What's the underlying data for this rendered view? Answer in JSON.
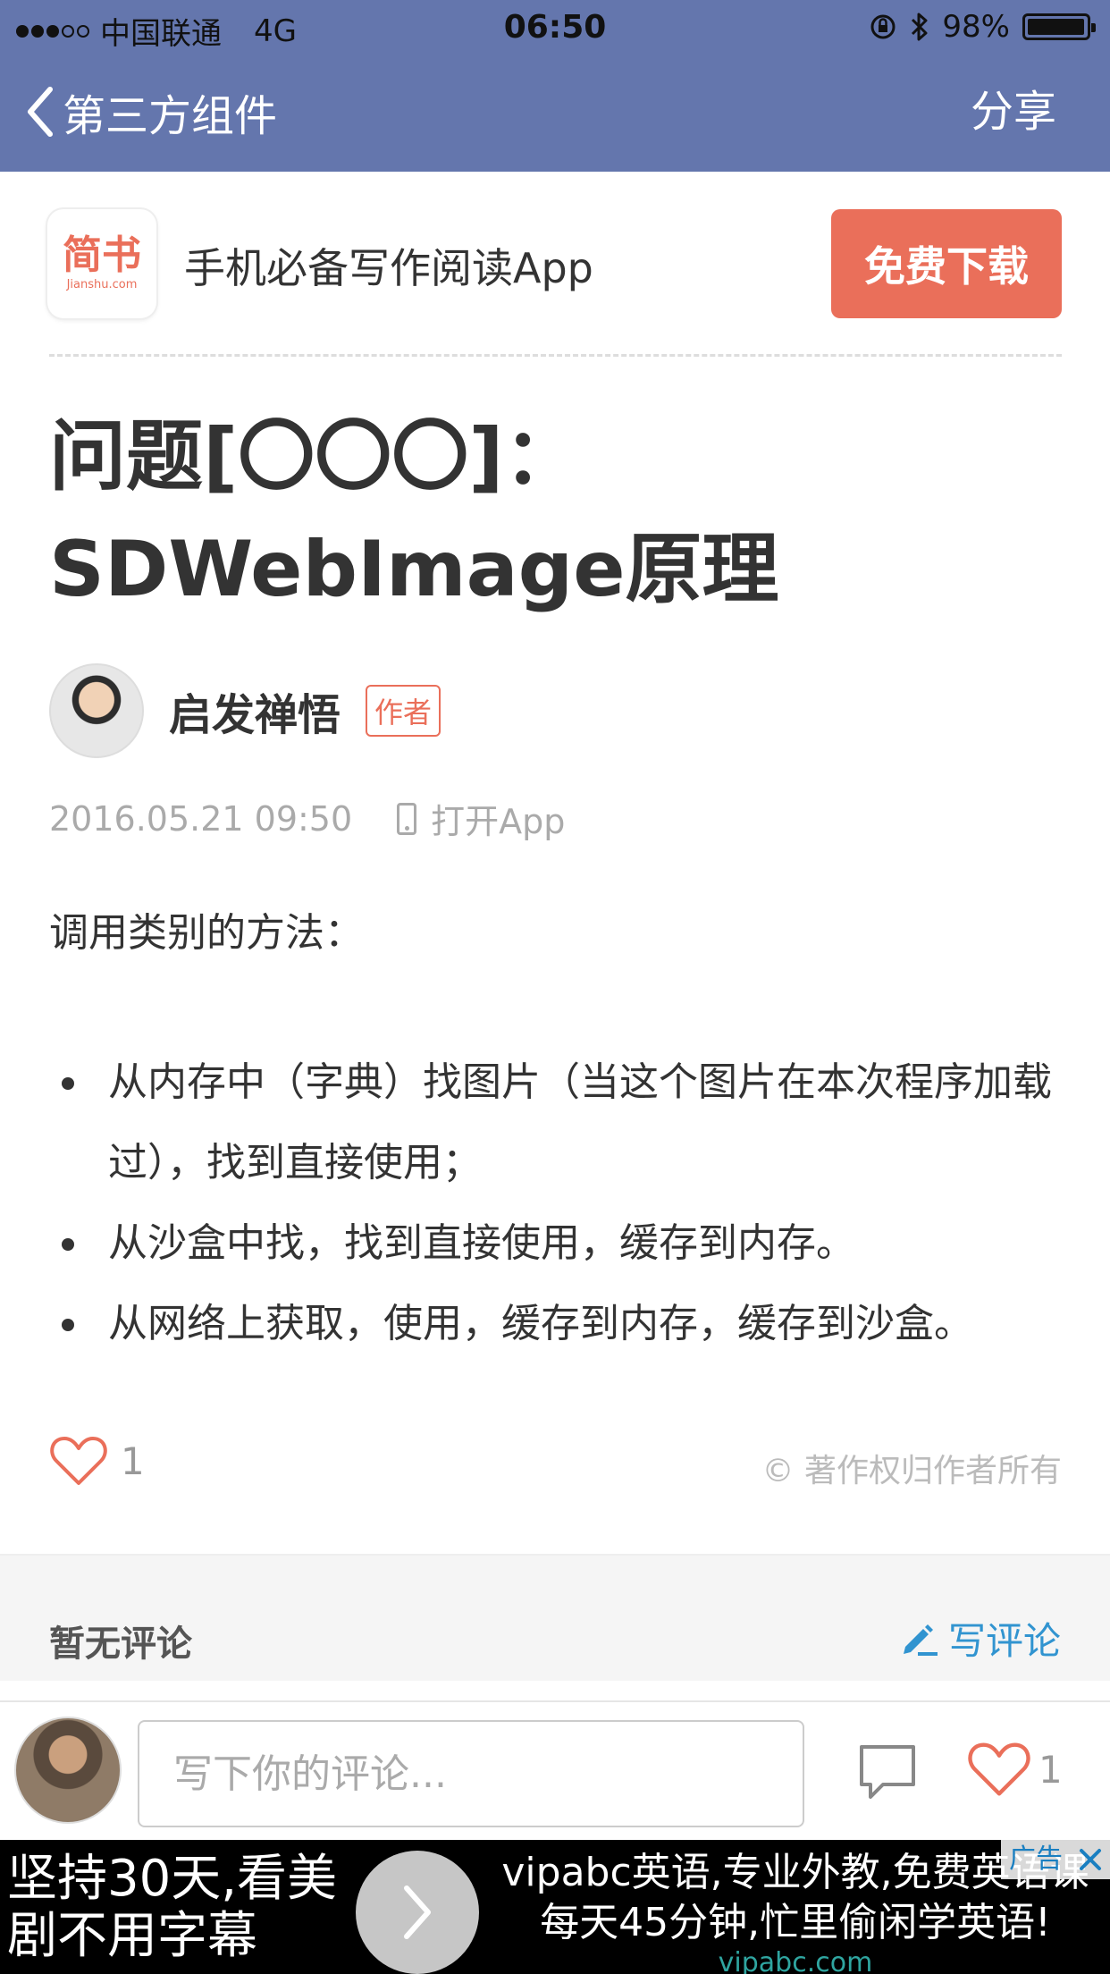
{
  "status_bar": {
    "carrier": "中国联通",
    "network": "4G",
    "time": "06:50",
    "battery": "98%",
    "battery_level": 0.98,
    "signal_bars_filled": 3,
    "signal_bars_total": 5
  },
  "nav": {
    "back_label": "第三方组件",
    "share_label": "分享"
  },
  "promo": {
    "logo_cn": "简书",
    "logo_en": "Jianshu.com",
    "tagline": "手机必备写作阅读App",
    "download_label": "免费下载"
  },
  "article": {
    "title_line1": "问题[〇〇〇]：",
    "title_line2": "SDWebImage原理",
    "author": "启发禅悟",
    "author_badge": "作者",
    "date": "2016.05.21 09:50",
    "open_app": "打开App",
    "intro": "调用类别的方法：",
    "bullets": [
      "从内存中（字典）找图片（当这个图片在本次程序加载过），找到直接使用；",
      "从沙盒中找，找到直接使用，缓存到内存。",
      "从网络上获取，使用，缓存到内存，缓存到沙盒。"
    ],
    "like_count": "1",
    "copyright": "© 著作权归作者所有"
  },
  "comments": {
    "empty_label": "暂无评论",
    "write_label": "写评论"
  },
  "comment_bar": {
    "placeholder": "写下你的评论...",
    "like_count": "1"
  },
  "ad": {
    "left_line1": "坚持30天,看美",
    "left_line2": "剧不用字幕",
    "right_line1": "vipabc英语,专业外教,免费英语课",
    "right_line2": "每天45分钟,忙里偷闲学英语!",
    "site": "vipabc.com",
    "tag": "广告"
  },
  "colors": {
    "nav_bg": "#6476ad",
    "accent": "#ea6f5a",
    "link_blue": "#3194d0"
  }
}
